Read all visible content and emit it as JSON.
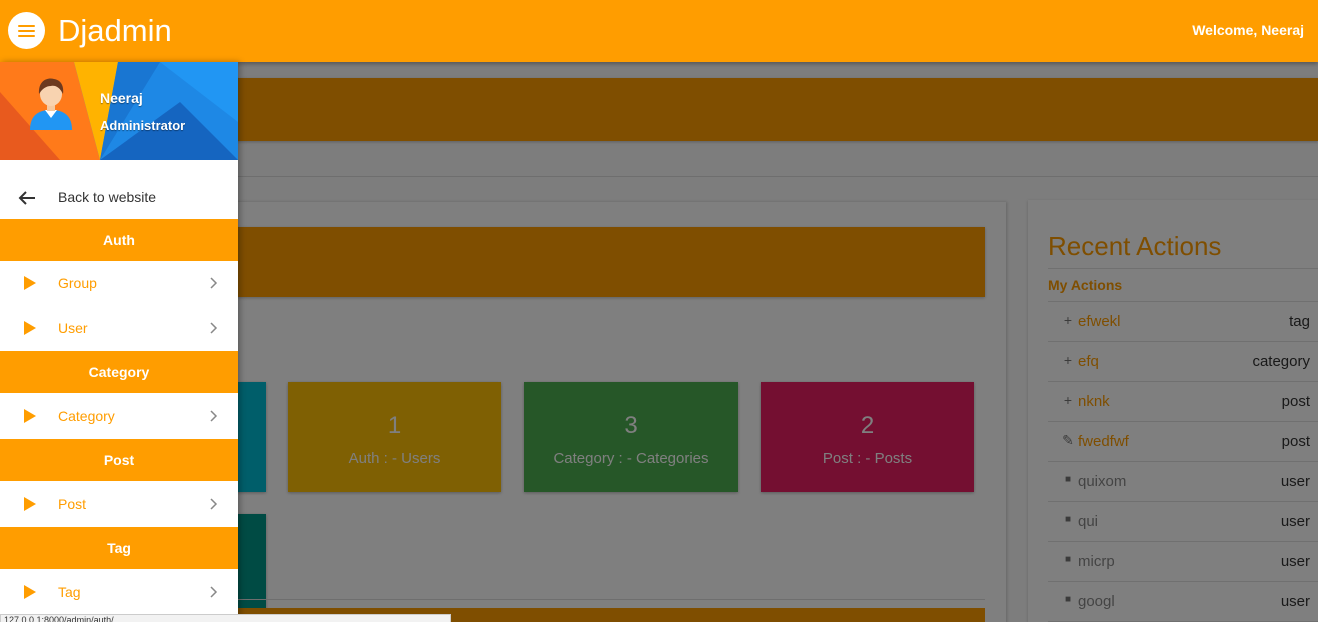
{
  "appbar": {
    "brand": "Djadmin",
    "welcome": "Welcome, Neeraj",
    "accent": "#ff9d00"
  },
  "drawer": {
    "user_name": "Neeraj",
    "user_role": "Administrator",
    "back_label": "Back to website",
    "sections": [
      {
        "title": "Auth",
        "items": [
          {
            "label": "Group"
          },
          {
            "label": "User"
          }
        ]
      },
      {
        "title": "Category",
        "items": [
          {
            "label": "Category"
          }
        ]
      },
      {
        "title": "Post",
        "items": [
          {
            "label": "Post"
          }
        ]
      },
      {
        "title": "Tag",
        "items": [
          {
            "label": "Tag"
          }
        ]
      }
    ]
  },
  "stats": [
    {
      "count": "1",
      "label": "Auth : - Users",
      "color": "#ffc107"
    },
    {
      "count": "3",
      "label": "Category : - Categories",
      "color": "#4caf50"
    },
    {
      "count": "2",
      "label": "Post : - Posts",
      "color": "#e91e63"
    }
  ],
  "recent_actions": {
    "title": "Recent Actions",
    "subtitle": "My Actions",
    "items": [
      {
        "icon": "plus-icon",
        "name": "efwekl",
        "type": "tag",
        "kind": "add"
      },
      {
        "icon": "plus-icon",
        "name": "efq",
        "type": "category",
        "kind": "add"
      },
      {
        "icon": "plus-icon",
        "name": "nknk",
        "type": "post",
        "kind": "add"
      },
      {
        "icon": "pencil-icon",
        "name": "fwedfwf",
        "type": "post",
        "kind": "change"
      },
      {
        "icon": "trash-icon",
        "name": "quixom",
        "type": "user",
        "kind": "delete"
      },
      {
        "icon": "trash-icon",
        "name": "qui",
        "type": "user",
        "kind": "delete"
      },
      {
        "icon": "trash-icon",
        "name": "micrp",
        "type": "user",
        "kind": "delete"
      },
      {
        "icon": "trash-icon",
        "name": "googl",
        "type": "user",
        "kind": "delete"
      }
    ]
  },
  "status_url": "127.0.0.1:8000/admin/auth/"
}
